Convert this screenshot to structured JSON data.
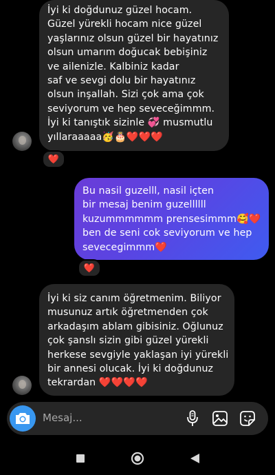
{
  "messages": [
    {
      "id": "msg1",
      "direction": "incoming",
      "lines": [
        "İyi ki doğdunuz güzel hocam.",
        "Güzel yürekli hocam nice güzel",
        "yaşlarınız olsun güzel bir hayatınız",
        "olsun umarım doğucak bebişiniz",
        "ve ailenizle. Kalbiniz kadar",
        "saf ve sevgi dolu bir hayatınız",
        "olsun inşallah. Sizi çok ama çok",
        "seviyorum ve hep seveceğimmm.",
        "İyi ki tanıştık sizinle 💞 musmutlu",
        "yıllaraaaaa🥳🎂❤️❤️❤️"
      ],
      "reaction": "❤️"
    },
    {
      "id": "msg2",
      "direction": "outgoing",
      "lines": [
        "Bu nasil guzelll, nasil içten",
        "bir mesaj benim guzellllll",
        "kuzummmmmm prensesimmm🥰❤️",
        "ben de seni cok seviyorum ve hep",
        "sevecegimmm❤️"
      ],
      "reaction": "❤️"
    },
    {
      "id": "msg3",
      "direction": "incoming",
      "lines": [
        "İyi ki siz canım öğretmenim. Biliyor",
        "musunuz artık öğretmenden çok",
        "arkadaşım ablam gibisiniz. Oğlunuz",
        "çok şanslı sizin gibi güzel yürekli",
        "herkese sevgiyle yaklaşan iyi yürekli",
        "bir annesi olucak. İyi ki doğdunuz",
        "tekrardan  ❤️❤️❤️❤️"
      ]
    }
  ],
  "composer": {
    "placeholder": "Mesaj...",
    "icons": [
      "camera-icon",
      "microphone-icon",
      "gallery-icon",
      "sticker-icon"
    ]
  },
  "navigation": {
    "icons": [
      "recents-square-icon",
      "home-circle-icon",
      "back-triangle-icon"
    ]
  },
  "colors": {
    "background": "#000000",
    "incoming_bubble": "#262626",
    "outgoing_gradient_start": "#6a3cd8",
    "outgoing_gradient_end": "#3f5bf0",
    "camera_button": "#3897f0",
    "heart": "#ff2d48"
  }
}
